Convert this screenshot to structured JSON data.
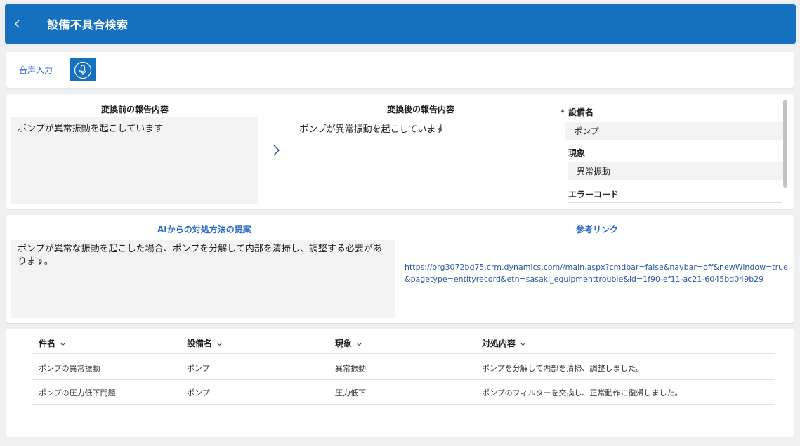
{
  "header": {
    "title": "設備不具合検索"
  },
  "voice": {
    "label": "音声入力"
  },
  "report": {
    "before_title": "変換前の報告内容",
    "before_text": "ポンプが異常振動を起こしています",
    "after_title": "変換後の報告内容",
    "after_text": "ポンプが異常振動を起こしています"
  },
  "form": {
    "required_mark": "*",
    "equipment_label": "設備名",
    "equipment_value": "ポンプ",
    "phenomenon_label": "現象",
    "phenomenon_value": "異常振動",
    "error_code_label": "エラーコード"
  },
  "ai": {
    "title": "AIからの対処方法の提案",
    "text": "ポンプが異常な振動を起こした場合、ポンプを分解して内部を清掃し、調整する必要があります。",
    "link_title": "参考リンク",
    "link_url": "https://org3072bd75.crm.dynamics.com//main.aspx?cmdbar=false&navbar=off&newWindow=true&pagetype=entityrecord&etn=sasaki_equipmenttrouble&id=1f90-ef11-ac21-6045bd049b29"
  },
  "table": {
    "columns": [
      "件名",
      "設備名",
      "現象",
      "対処内容"
    ],
    "rows": [
      [
        "ポンプの異常振動",
        "ポンプ",
        "異常振動",
        "ポンプを分解して内部を清掃、調整しました。"
      ],
      [
        "ポンプの圧力低下問題",
        "ポンプ",
        "圧力低下",
        "ポンプのフィルターを交換し、正常動作に復帰しました。"
      ]
    ]
  },
  "icons": {
    "back": "chevron-left-icon",
    "mic": "microphone-icon",
    "arrow": "chevron-right-icon",
    "sort": "chevron-down-icon"
  },
  "colors": {
    "brand": "#1670c0",
    "link": "#2b6cc8"
  }
}
